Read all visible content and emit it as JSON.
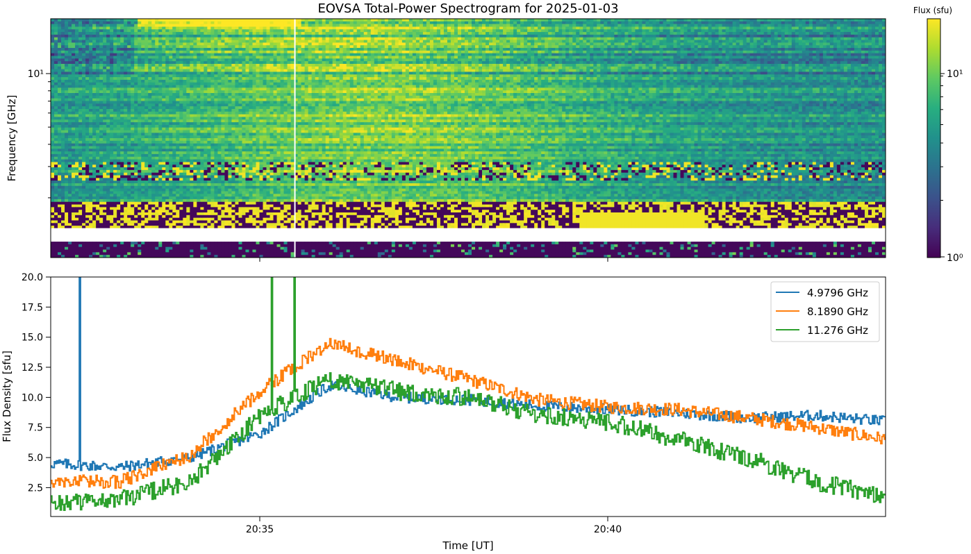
{
  "chart_data": [
    {
      "type": "heatmap",
      "title": "EOVSA Total-Power Spectrogram for 2025-01-03",
      "xlabel": "",
      "ylabel": "Frequency [GHz]",
      "y_scale": "log",
      "y_tick_labels": [
        "10¹"
      ],
      "colorbar": {
        "label": "Flux (sfu)",
        "scale": "log",
        "range": [
          1,
          18
        ],
        "tick_labels": [
          "10⁰",
          "10¹"
        ],
        "colormap": "viridis"
      },
      "x_range": [
        "20:32:00",
        "20:44:00"
      ],
      "y_range_ghz": [
        1.0,
        18.0
      ],
      "shared_x_tick_labels": [
        "20:35",
        "20:40"
      ],
      "notable_features": {
        "gap_time": "20:35:30",
        "missing_band_ghz": [
          1.15,
          1.35
        ]
      }
    },
    {
      "type": "line",
      "xlabel": "Time [UT]",
      "ylabel": "Flux Density [sfu]",
      "x_tick_labels": [
        "20:35",
        "20:40"
      ],
      "x_range": [
        "20:32:00",
        "20:44:00"
      ],
      "ylim": [
        0.1,
        20
      ],
      "y_ticks": [
        "2.5",
        "5.0",
        "7.5",
        "10.0",
        "12.5",
        "15.0",
        "17.5",
        "20.0"
      ],
      "legend_position": "top-right",
      "x": [
        "20:32",
        "20:33",
        "20:34",
        "20:35",
        "20:36",
        "20:37",
        "20:38",
        "20:39",
        "20:40",
        "20:41",
        "20:42",
        "20:43",
        "20:44"
      ],
      "series": [
        {
          "name": "4.9796 GHz",
          "color": "#1f77b4",
          "values": [
            4.5,
            4.2,
            5.0,
            7.0,
            11.0,
            10.0,
            9.8,
            9.3,
            9.0,
            8.7,
            8.3,
            8.5,
            8.0
          ]
        },
        {
          "name": "8.1890 GHz",
          "color": "#ff7f0e",
          "values": [
            3.0,
            3.0,
            5.2,
            10.5,
            14.5,
            13.0,
            11.5,
            9.8,
            9.2,
            9.0,
            8.3,
            7.5,
            6.5
          ]
        },
        {
          "name": "11.276 GHz",
          "color": "#2ca02c",
          "values": [
            1.2,
            1.5,
            3.0,
            8.5,
            11.5,
            10.5,
            10.0,
            8.5,
            8.0,
            6.5,
            5.0,
            3.0,
            1.8
          ]
        }
      ],
      "spikes": [
        {
          "series": "4.9796 GHz",
          "time": "20:32:25",
          "value": 20
        },
        {
          "series": "11.276 GHz",
          "time": "20:35:10",
          "value": 20
        },
        {
          "series": "11.276 GHz",
          "time": "20:35:30",
          "value": 20
        }
      ]
    }
  ]
}
